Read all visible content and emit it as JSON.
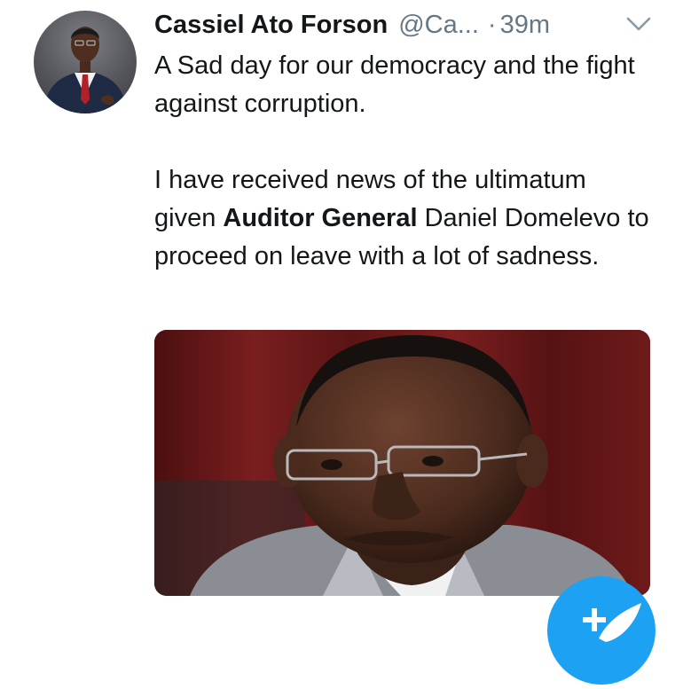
{
  "tweet": {
    "author_name": "Cassiel Ato Forson",
    "handle": "@Ca...",
    "separator": "·",
    "time": "39m",
    "text": {
      "p1": "A Sad day for our democracy and the fight against corruption.",
      "p2_before": "I have received news of the ultimatum given ",
      "p2_bold": "Auditor General",
      "p2_after": " Daniel Domelevo to proceed on leave with a lot of sadness."
    }
  },
  "icons": {
    "caret": "chevron-down-icon",
    "compose": "compose-tweet-icon"
  },
  "colors": {
    "text": "#14171a",
    "secondary": "#657786",
    "accent": "#1da1f2"
  }
}
